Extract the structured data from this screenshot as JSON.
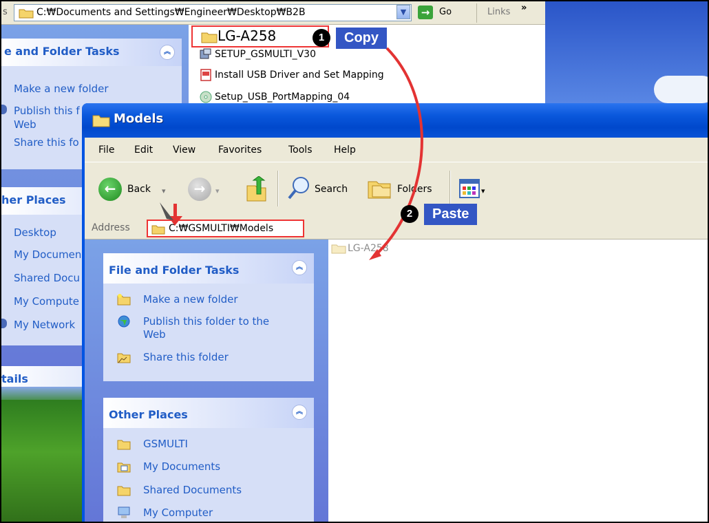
{
  "back_window": {
    "address_lead": "s",
    "address_path": "C:₩Documents and Settings₩Engineer₩Desktop₩B2B",
    "go_label": "Go",
    "links_label": "Links",
    "links_chevron": "»",
    "file_tasks_title": "e and Folder Tasks",
    "file_tasks": [
      "Make a new folder",
      "Publish this f",
      "Web",
      "Share this fo"
    ],
    "other_places_title": "her Places",
    "other_places": [
      "Desktop",
      "My Documen",
      "Shared Docu",
      "My Compute",
      "My Network"
    ],
    "details_title": "tails",
    "files": [
      "LG-A258",
      "SETUP_GSMULTI_V30",
      "Install USB Driver and Set Mapping",
      "Setup_USB_PortMapping_04"
    ]
  },
  "front_window": {
    "title": "Models",
    "menu": [
      "File",
      "Edit",
      "View",
      "Favorites",
      "Tools",
      "Help"
    ],
    "toolbar": {
      "back": "Back",
      "search": "Search",
      "folders": "Folders"
    },
    "address_label": "Address",
    "address_path": "C:₩GSMULTI₩Models",
    "file_tasks_title": "File and Folder Tasks",
    "file_tasks": [
      "Make a new folder",
      "Publish this folder to the Web",
      "Share this folder"
    ],
    "other_places_title": "Other Places",
    "other_places": [
      "GSMULTI",
      "My Documents",
      "Shared Documents",
      "My Computer"
    ],
    "pasted_item": "LG-A258"
  },
  "annotations": {
    "step1_number": "1",
    "step1_label": "Copy",
    "step2_number": "2",
    "step2_label": "Paste",
    "accent_color": "#e33333",
    "callout_color": "#3356c4"
  }
}
